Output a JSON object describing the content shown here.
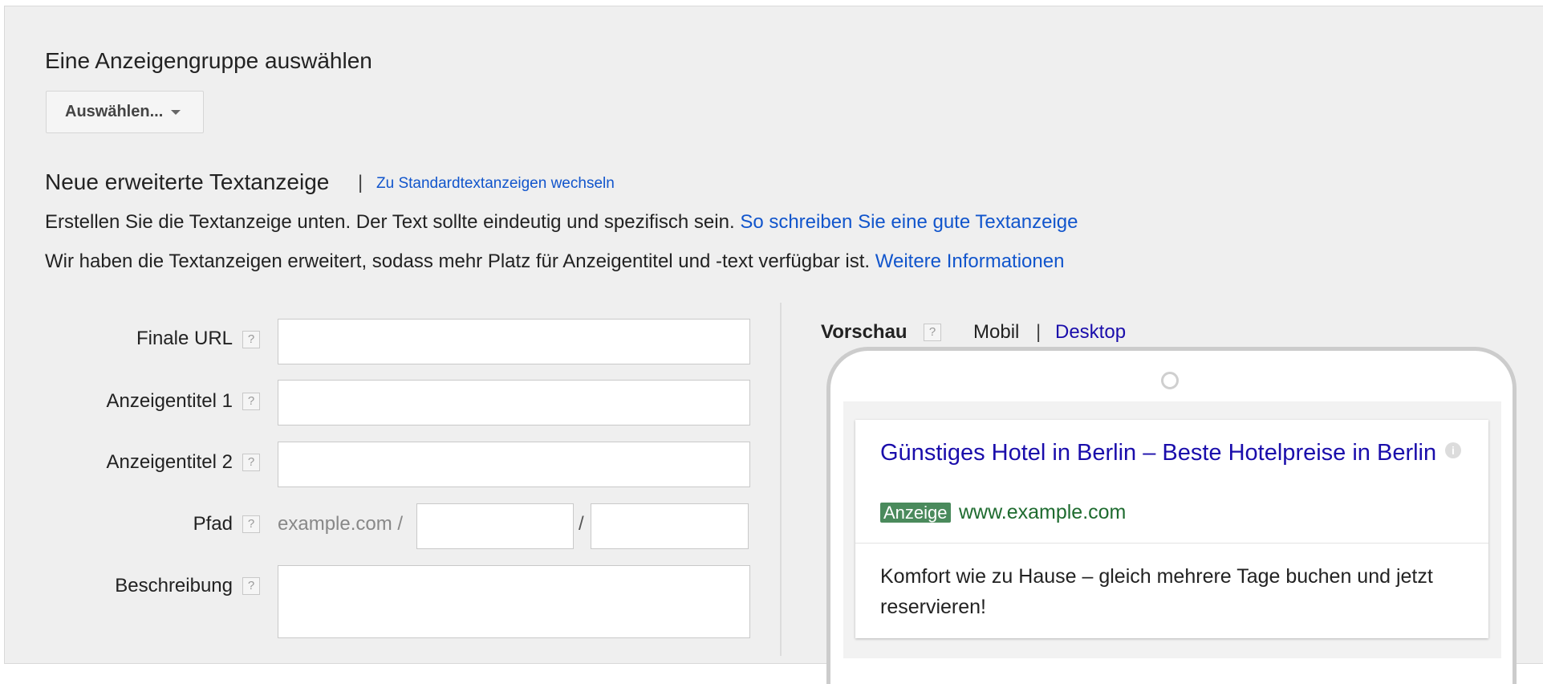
{
  "adgroup": {
    "heading": "Eine Anzeigengruppe auswählen",
    "select_label": "Auswählen..."
  },
  "section": {
    "heading": "Neue erweiterte Textanzeige",
    "separator": "|",
    "switch_link": "Zu Standardtextanzeigen wechseln"
  },
  "info": {
    "line1_text": "Erstellen Sie die Textanzeige unten. Der Text sollte eindeutig und spezifisch sein.",
    "line1_link": "So schreiben Sie eine gute Textanzeige",
    "line2_text": "Wir haben die Textanzeigen erweitert, sodass mehr Platz für Anzeigentitel und -text verfügbar ist.",
    "line2_link": "Weitere Informationen"
  },
  "form": {
    "help_glyph": "?",
    "final_url_label": "Finale URL",
    "final_url_value": "",
    "headline1_label": "Anzeigentitel 1",
    "headline1_value": "",
    "headline2_label": "Anzeigentitel 2",
    "headline2_value": "",
    "path_label": "Pfad",
    "path_domain": "example.com /",
    "path_separator": "/",
    "path1_value": "",
    "path2_value": "",
    "description_label": "Beschreibung",
    "description_value": ""
  },
  "preview": {
    "heading": "Vorschau",
    "mobile_label": "Mobil",
    "separator": "|",
    "desktop_label": "Desktop",
    "ad": {
      "title": "Günstiges Hotel in Berlin – Beste Hotelpreise in Berlin",
      "badge": "Anzeige",
      "display_url": "www.example.com",
      "description": "Komfort wie zu Hause – gleich mehrere Tage buchen und jetzt reservieren!",
      "info_glyph": "i"
    }
  },
  "colors": {
    "link": "#1155cc",
    "ad_title": "#1a0dab",
    "ad_url": "#1e6b2f",
    "badge_bg": "#4a8a5c",
    "panel_bg": "#efefef"
  }
}
